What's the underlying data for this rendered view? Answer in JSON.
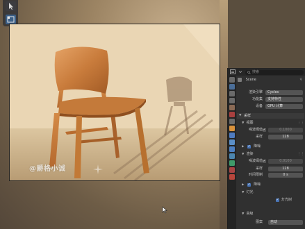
{
  "render": {
    "watermark": "@爵格小诚"
  },
  "properties": {
    "search_placeholder": "搜索",
    "scene_label": "Scene",
    "render_engine": {
      "label": "渲染引擎",
      "value": "Cycles"
    },
    "feature_set": {
      "label": "功能集",
      "value": "支持特性"
    },
    "device": {
      "label": "设备",
      "value": "GPU 计算"
    },
    "sampling": {
      "title": "采样",
      "viewport": {
        "title": "视图",
        "noise_threshold": {
          "label": "噪波阈值",
          "value": "0.1000"
        },
        "samples": {
          "label": "采样",
          "value": "128"
        },
        "denoise": {
          "label": "降噪"
        }
      },
      "render": {
        "title": "渲染",
        "noise_threshold": {
          "label": "噪波阈值",
          "value": "0.0100"
        },
        "samples": {
          "label": "采样",
          "value": "128"
        },
        "time_limit": {
          "label": "时间限制",
          "value": "0 s"
        },
        "denoise": {
          "label": "降噪"
        }
      },
      "lights": {
        "title": "灯光",
        "light_tree": "灯光树"
      },
      "advanced": {
        "title": "高级",
        "pattern": {
          "label": "图案",
          "value": "自动"
        }
      }
    }
  },
  "colors": {
    "accent": "#4772b3",
    "panel": "#303030",
    "field": "#545454"
  }
}
